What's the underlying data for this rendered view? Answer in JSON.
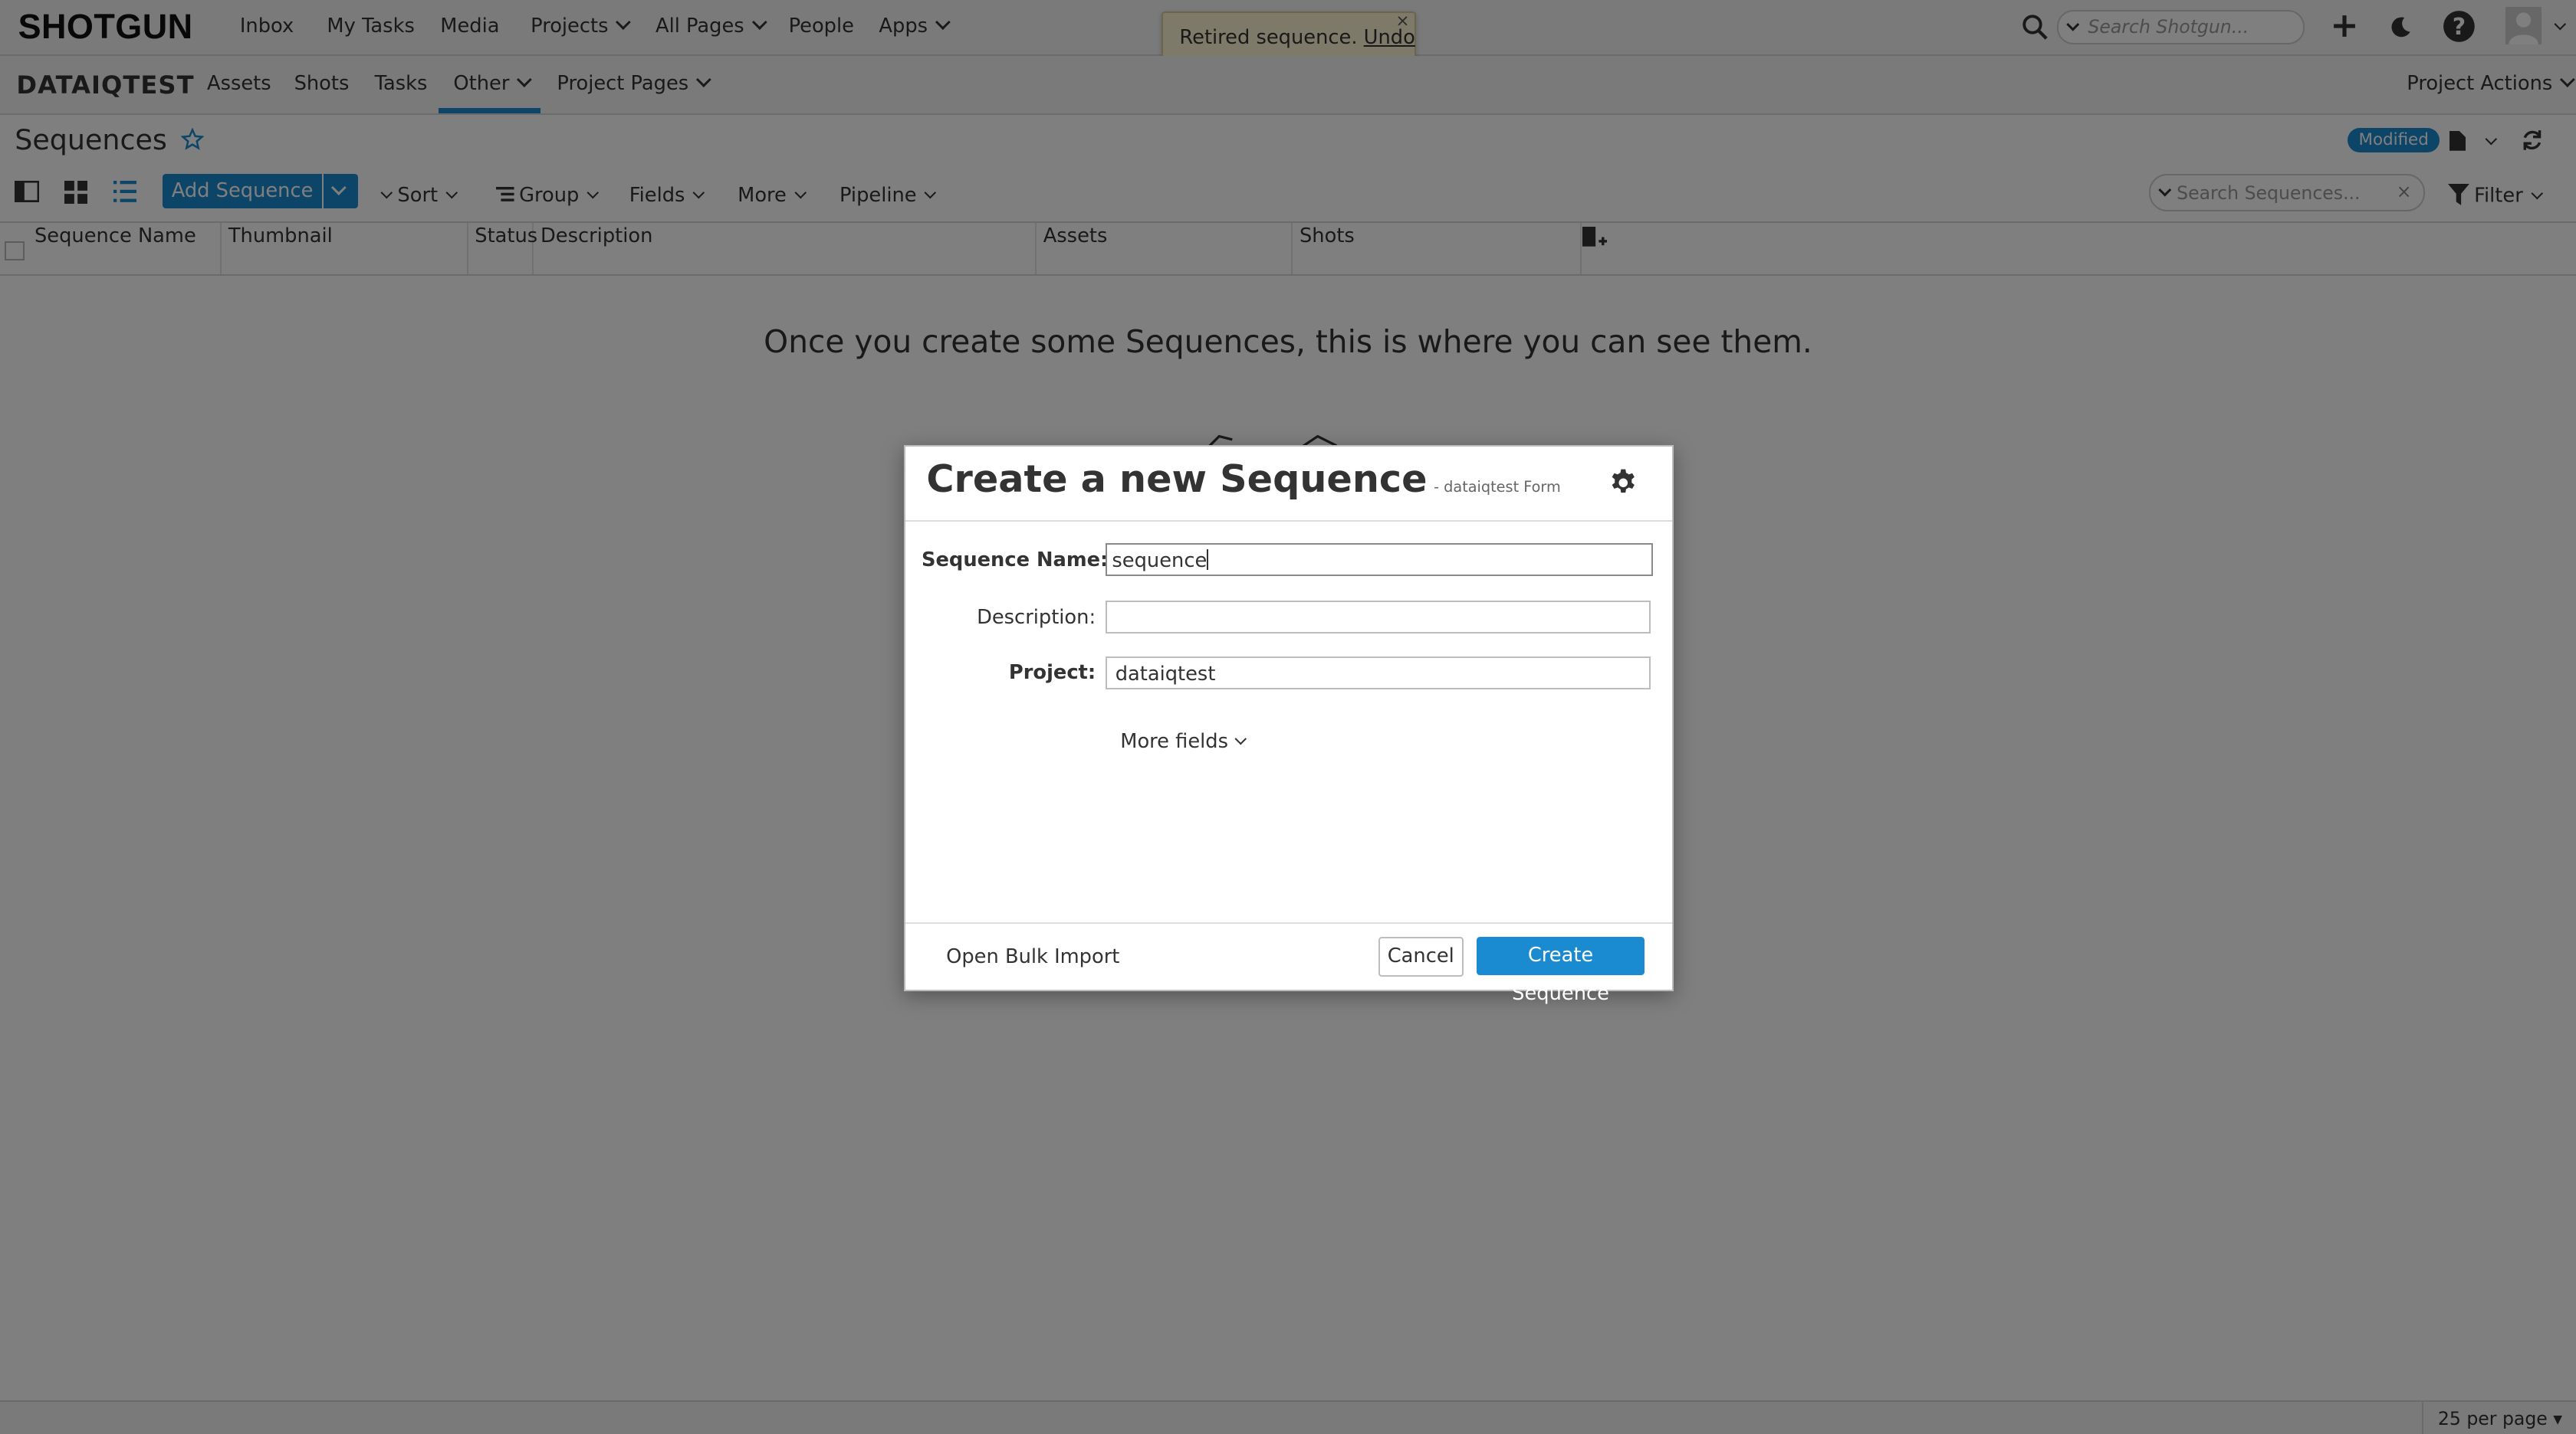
{
  "app": {
    "logo": "SHOTGUN",
    "nav": {
      "inbox": "Inbox",
      "my_tasks": "My Tasks",
      "media": "Media",
      "projects": "Projects",
      "all_pages": "All Pages",
      "people": "People",
      "apps": "Apps"
    },
    "search_placeholder": "Search Shotgun..."
  },
  "toast": {
    "message": "Retired sequence.",
    "undo": "Undo",
    "close": "×"
  },
  "project": {
    "name": "DATAIQTEST",
    "tabs": {
      "assets": "Assets",
      "shots": "Shots",
      "tasks": "Tasks",
      "other": "Other",
      "project_pages": "Project Pages"
    },
    "active_tab": "Other",
    "actions": "Project Actions"
  },
  "page": {
    "title": "Sequences",
    "badge": "Modified"
  },
  "toolbar": {
    "add": "Add Sequence",
    "sort": "Sort",
    "group": "Group",
    "fields": "Fields",
    "more": "More",
    "pipeline": "Pipeline",
    "search_placeholder": "Search Sequences...",
    "search_clear": "×",
    "filter": "Filter"
  },
  "grid": {
    "columns": {
      "name": "Sequence Name",
      "thumbnail": "Thumbnail",
      "status": "Status",
      "description": "Description",
      "assets": "Assets",
      "shots": "Shots"
    },
    "empty_message": "Once you create some Sequences, this is where you can see them."
  },
  "footer": {
    "per_page": "25 per page ▾"
  },
  "modal": {
    "title": "Create a new Sequence",
    "subtitle": "- dataiqtest Form",
    "fields": {
      "name_label": "Sequence Name:",
      "name_value": "sequence",
      "description_label": "Description:",
      "description_value": "",
      "project_label": "Project:",
      "project_value": "dataiqtest"
    },
    "more_fields": "More fields",
    "bulk_import": "Open Bulk Import",
    "cancel": "Cancel",
    "submit": "Create Sequence"
  },
  "colors": {
    "accent": "#1a8bd1",
    "toast_bg": "#fbf4d2",
    "overlay": "rgba(0,0,0,0.5)"
  }
}
